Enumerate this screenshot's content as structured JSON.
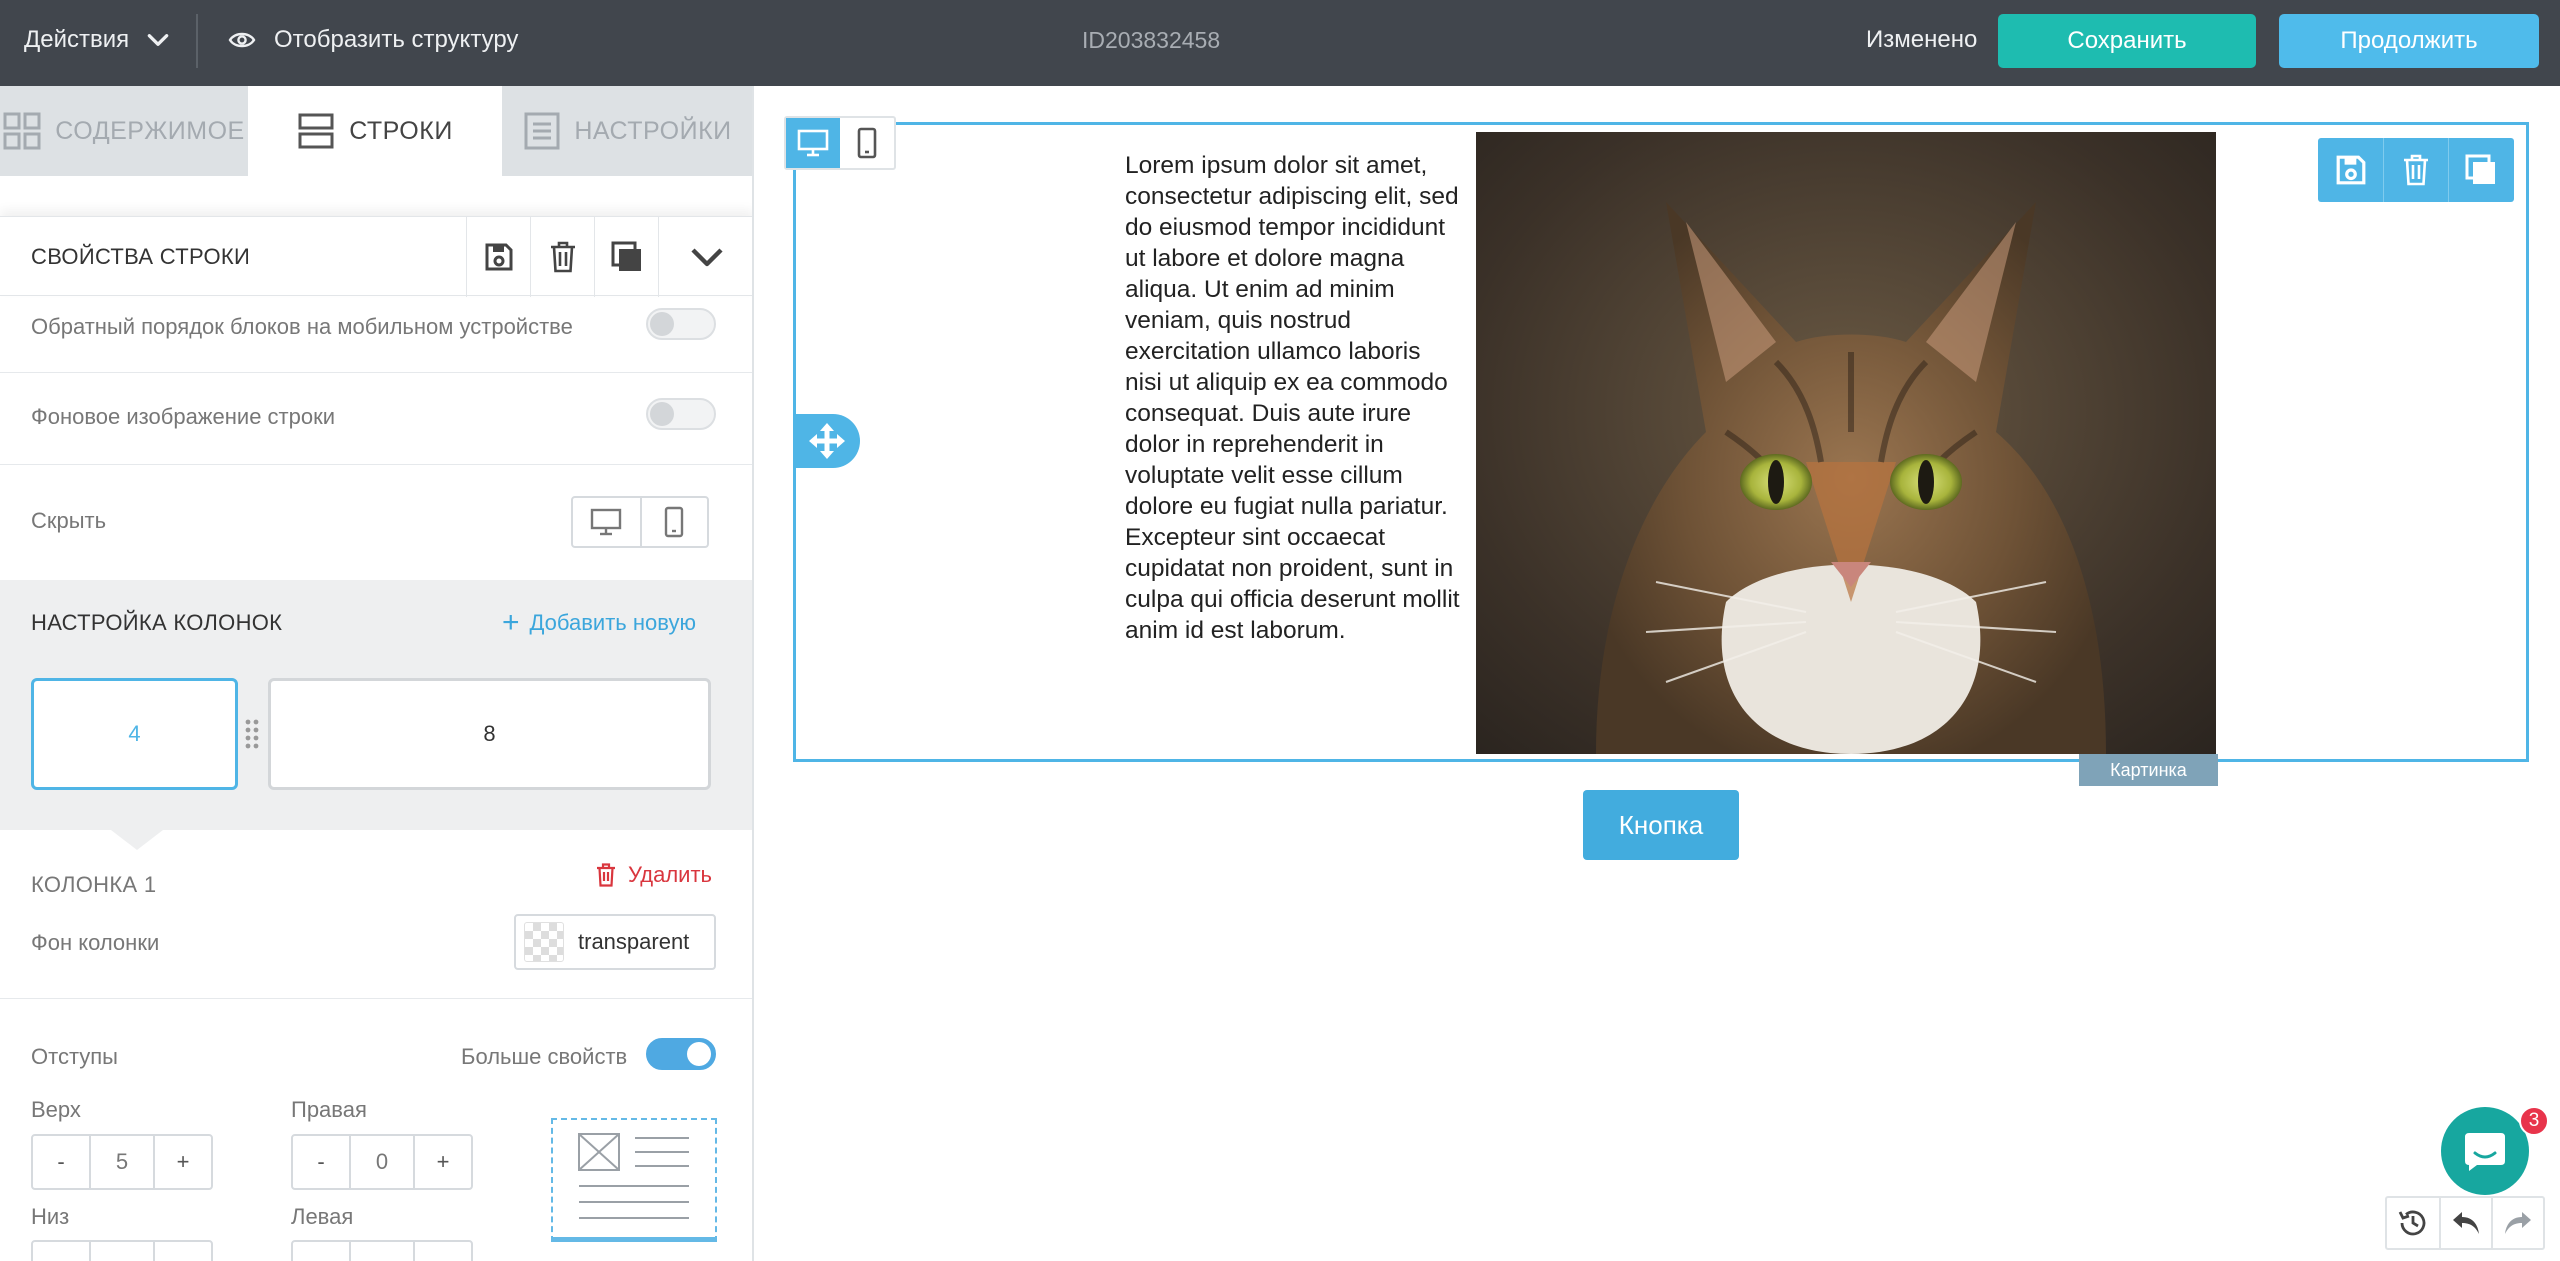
{
  "topbar": {
    "actions_label": "Действия",
    "structure_label": "Отобразить структуру",
    "project_id": "ID203832458",
    "status": "Изменено",
    "save_label": "Сохранить",
    "continue_label": "Продолжить"
  },
  "tabs": [
    {
      "label": "СОДЕРЖИМОЕ"
    },
    {
      "label": "СТРОКИ"
    },
    {
      "label": "НАСТРОЙКИ"
    }
  ],
  "row_props": {
    "title": "СВОЙСТВА СТРОКИ",
    "reverse_mobile_label": "Обратный порядок блоков на мобильном устройстве",
    "bg_image_label": "Фоновое изображение строки",
    "hide_label": "Скрыть"
  },
  "columns": {
    "title": "НАСТРОЙКА КОЛОНОК",
    "add_new": "Добавить новую",
    "widths": [
      "4",
      "8"
    ],
    "col1_title": "КОЛОНКА 1",
    "delete_label": "Удалить",
    "bg_label": "Фон колонки",
    "bg_value": "transparent"
  },
  "padding": {
    "title": "Отступы",
    "more_props": "Больше свойств",
    "top_label": "Верх",
    "top_value": "5",
    "right_label": "Правая",
    "right_value": "0",
    "bottom_label": "Низ",
    "left_label": "Левая",
    "minus": "-",
    "plus": "+"
  },
  "canvas": {
    "lorem": "Lorem ipsum dolor sit amet, consectetur adipiscing elit, sed do eiusmod tempor incididunt ut labore et dolore magna aliqua. Ut enim ad minim veniam, quis nostrud exercitation ullamco laboris nisi ut aliquip ex ea commodo consequat. Duis aute irure dolor in reprehenderit in voluptate velit esse cillum dolore eu fugiat nulla pariatur. Excepteur sint occaecat cupidatat non proident, sunt in culpa qui officia deserunt mollit anim id est laborum.",
    "image_tag": "Картинка",
    "button_label": "Кнопка"
  },
  "chat": {
    "badge": "3"
  },
  "colors": {
    "topbar": "#41464d",
    "save": "#1ebcb0",
    "continue": "#4fbbeb",
    "accent": "#4fb5e6",
    "danger": "#d9363e"
  }
}
